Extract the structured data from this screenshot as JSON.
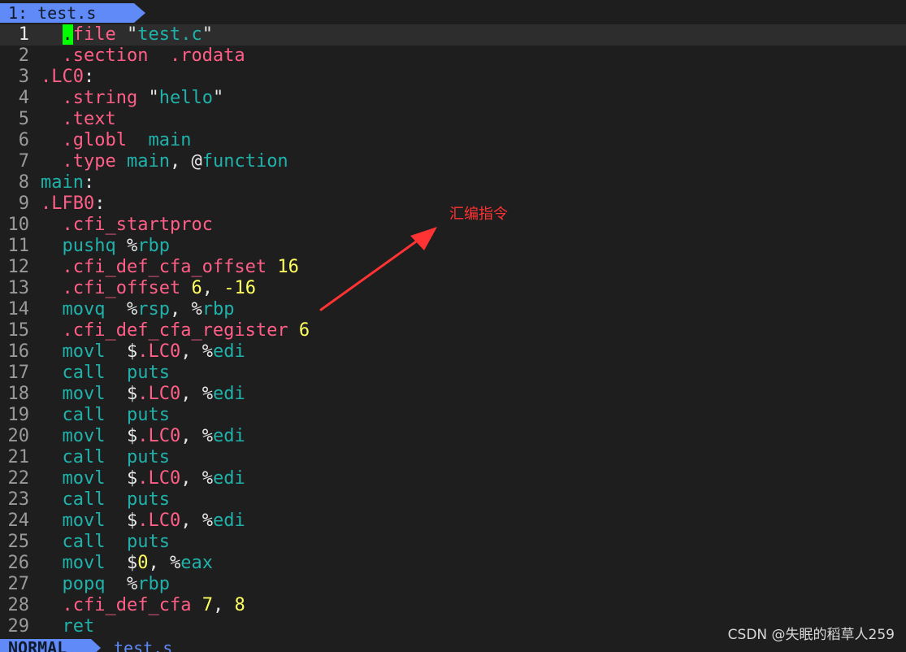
{
  "tab": {
    "label": "1: test.s"
  },
  "status": {
    "mode": "NORMAL",
    "file": "test.s"
  },
  "annotation": {
    "text": "汇编指令",
    "color": "#ff3333"
  },
  "watermark": {
    "text": "CSDN @失眠的稻草人259"
  },
  "colors": {
    "accent": "#5f8af7",
    "directive": "#ff5f87",
    "string": "#20b2aa",
    "number": "#ffff5f",
    "cursor": "#00ff00"
  },
  "lines": [
    {
      "n": "1",
      "seg": [
        {
          "t": ".",
          "c": "cursor"
        },
        {
          "t": "file ",
          "c": "dir"
        },
        {
          "t": "\"",
          "c": "white"
        },
        {
          "t": "test.c",
          "c": "str"
        },
        {
          "t": "\"",
          "c": "white"
        }
      ],
      "indent": "  ",
      "current": true
    },
    {
      "n": "2",
      "seg": [
        {
          "t": ".section  .rodata",
          "c": "dir"
        }
      ],
      "indent": "  "
    },
    {
      "n": "3",
      "seg": [
        {
          "t": ".LC0",
          "c": "lbl"
        },
        {
          "t": ":",
          "c": "white"
        }
      ],
      "indent": ""
    },
    {
      "n": "4",
      "seg": [
        {
          "t": ".string ",
          "c": "dir"
        },
        {
          "t": "\"",
          "c": "white"
        },
        {
          "t": "hello",
          "c": "str"
        },
        {
          "t": "\"",
          "c": "white"
        }
      ],
      "indent": "  "
    },
    {
      "n": "5",
      "seg": [
        {
          "t": ".text",
          "c": "dir"
        }
      ],
      "indent": "  "
    },
    {
      "n": "6",
      "seg": [
        {
          "t": ".globl  ",
          "c": "dir"
        },
        {
          "t": "main",
          "c": "ins"
        }
      ],
      "indent": "  "
    },
    {
      "n": "7",
      "seg": [
        {
          "t": ".type ",
          "c": "dir"
        },
        {
          "t": "main",
          "c": "ins"
        },
        {
          "t": ", @",
          "c": "white"
        },
        {
          "t": "function",
          "c": "ins"
        }
      ],
      "indent": "  "
    },
    {
      "n": "8",
      "seg": [
        {
          "t": "main",
          "c": "ins"
        },
        {
          "t": ":",
          "c": "white"
        }
      ],
      "indent": ""
    },
    {
      "n": "9",
      "seg": [
        {
          "t": ".LFB0",
          "c": "lbl"
        },
        {
          "t": ":",
          "c": "white"
        }
      ],
      "indent": ""
    },
    {
      "n": "10",
      "seg": [
        {
          "t": ".cfi_startproc",
          "c": "dir"
        }
      ],
      "indent": "  "
    },
    {
      "n": "11",
      "seg": [
        {
          "t": "pushq ",
          "c": "ins"
        },
        {
          "t": "%",
          "c": "white"
        },
        {
          "t": "rbp",
          "c": "ins"
        }
      ],
      "indent": "  "
    },
    {
      "n": "12",
      "seg": [
        {
          "t": ".cfi_def_cfa_offset ",
          "c": "dir"
        },
        {
          "t": "16",
          "c": "num"
        }
      ],
      "indent": "  "
    },
    {
      "n": "13",
      "seg": [
        {
          "t": ".cfi_offset ",
          "c": "dir"
        },
        {
          "t": "6",
          "c": "num"
        },
        {
          "t": ", ",
          "c": "white"
        },
        {
          "t": "-16",
          "c": "num"
        }
      ],
      "indent": "  "
    },
    {
      "n": "14",
      "seg": [
        {
          "t": "movq  ",
          "c": "ins"
        },
        {
          "t": "%",
          "c": "white"
        },
        {
          "t": "rsp",
          "c": "ins"
        },
        {
          "t": ", %",
          "c": "white"
        },
        {
          "t": "rbp",
          "c": "ins"
        }
      ],
      "indent": "  "
    },
    {
      "n": "15",
      "seg": [
        {
          "t": ".cfi_def_cfa_register ",
          "c": "dir"
        },
        {
          "t": "6",
          "c": "num"
        }
      ],
      "indent": "  "
    },
    {
      "n": "16",
      "seg": [
        {
          "t": "movl  ",
          "c": "ins"
        },
        {
          "t": "$",
          "c": "white"
        },
        {
          "t": ".LC0",
          "c": "lbl"
        },
        {
          "t": ", %",
          "c": "white"
        },
        {
          "t": "edi",
          "c": "ins"
        }
      ],
      "indent": "  "
    },
    {
      "n": "17",
      "seg": [
        {
          "t": "call  puts",
          "c": "ins"
        }
      ],
      "indent": "  "
    },
    {
      "n": "18",
      "seg": [
        {
          "t": "movl  ",
          "c": "ins"
        },
        {
          "t": "$",
          "c": "white"
        },
        {
          "t": ".LC0",
          "c": "lbl"
        },
        {
          "t": ", %",
          "c": "white"
        },
        {
          "t": "edi",
          "c": "ins"
        }
      ],
      "indent": "  "
    },
    {
      "n": "19",
      "seg": [
        {
          "t": "call  puts",
          "c": "ins"
        }
      ],
      "indent": "  "
    },
    {
      "n": "20",
      "seg": [
        {
          "t": "movl  ",
          "c": "ins"
        },
        {
          "t": "$",
          "c": "white"
        },
        {
          "t": ".LC0",
          "c": "lbl"
        },
        {
          "t": ", %",
          "c": "white"
        },
        {
          "t": "edi",
          "c": "ins"
        }
      ],
      "indent": "  "
    },
    {
      "n": "21",
      "seg": [
        {
          "t": "call  puts",
          "c": "ins"
        }
      ],
      "indent": "  "
    },
    {
      "n": "22",
      "seg": [
        {
          "t": "movl  ",
          "c": "ins"
        },
        {
          "t": "$",
          "c": "white"
        },
        {
          "t": ".LC0",
          "c": "lbl"
        },
        {
          "t": ", %",
          "c": "white"
        },
        {
          "t": "edi",
          "c": "ins"
        }
      ],
      "indent": "  "
    },
    {
      "n": "23",
      "seg": [
        {
          "t": "call  puts",
          "c": "ins"
        }
      ],
      "indent": "  "
    },
    {
      "n": "24",
      "seg": [
        {
          "t": "movl  ",
          "c": "ins"
        },
        {
          "t": "$",
          "c": "white"
        },
        {
          "t": ".LC0",
          "c": "lbl"
        },
        {
          "t": ", %",
          "c": "white"
        },
        {
          "t": "edi",
          "c": "ins"
        }
      ],
      "indent": "  "
    },
    {
      "n": "25",
      "seg": [
        {
          "t": "call  puts",
          "c": "ins"
        }
      ],
      "indent": "  "
    },
    {
      "n": "26",
      "seg": [
        {
          "t": "movl  ",
          "c": "ins"
        },
        {
          "t": "$",
          "c": "white"
        },
        {
          "t": "0",
          "c": "num"
        },
        {
          "t": ", %",
          "c": "white"
        },
        {
          "t": "eax",
          "c": "ins"
        }
      ],
      "indent": "  "
    },
    {
      "n": "27",
      "seg": [
        {
          "t": "popq  ",
          "c": "ins"
        },
        {
          "t": "%",
          "c": "white"
        },
        {
          "t": "rbp",
          "c": "ins"
        }
      ],
      "indent": "  "
    },
    {
      "n": "28",
      "seg": [
        {
          "t": ".cfi_def_cfa ",
          "c": "dir"
        },
        {
          "t": "7",
          "c": "num"
        },
        {
          "t": ", ",
          "c": "white"
        },
        {
          "t": "8",
          "c": "num"
        }
      ],
      "indent": "  "
    },
    {
      "n": "29",
      "seg": [
        {
          "t": "ret",
          "c": "ins"
        }
      ],
      "indent": "  "
    }
  ]
}
